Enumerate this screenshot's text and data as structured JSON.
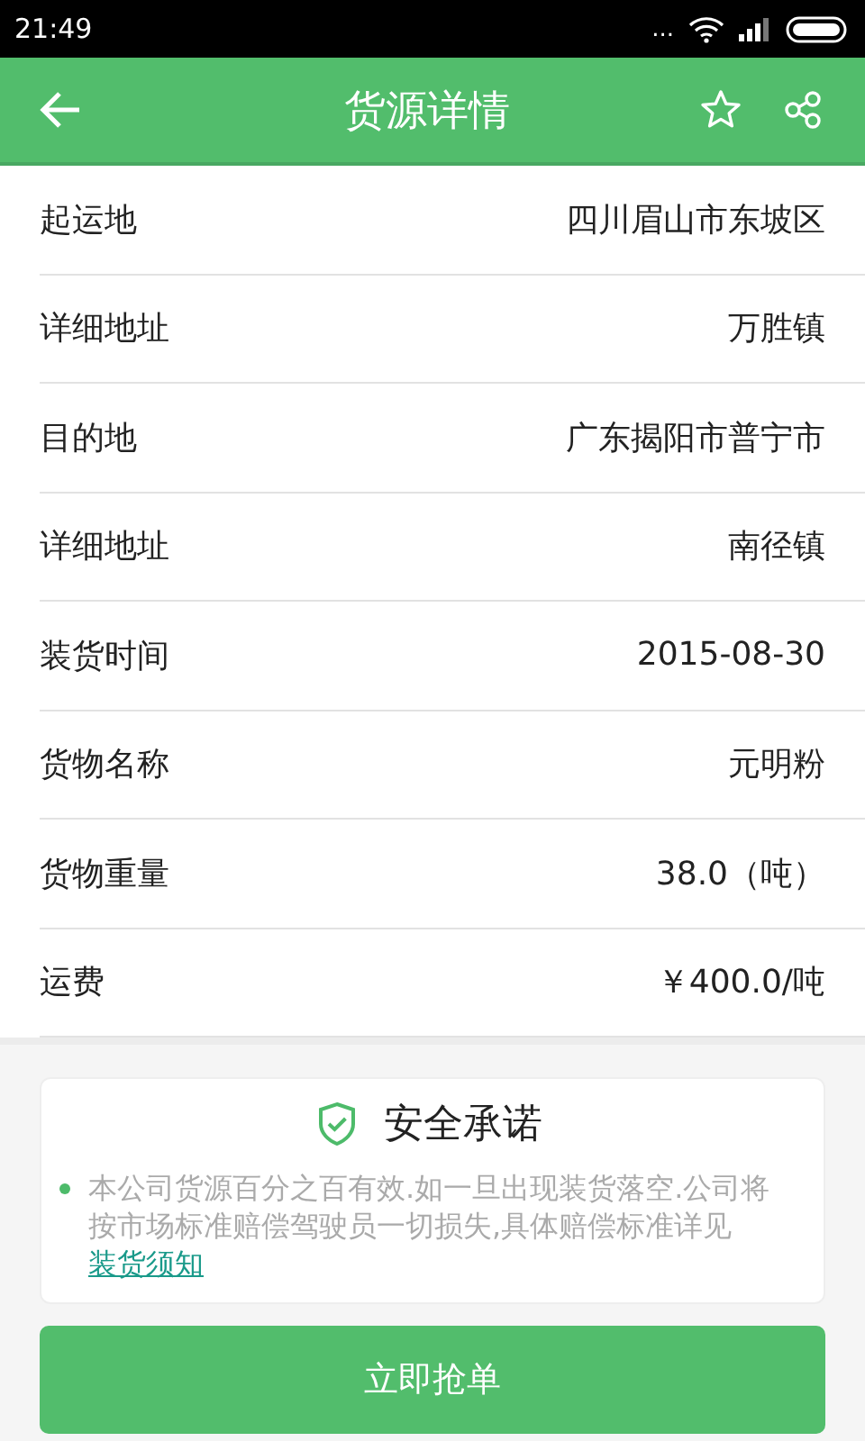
{
  "status_bar": {
    "time": "21:49",
    "dots": "..."
  },
  "header": {
    "title": "货源详情"
  },
  "rows": [
    {
      "label": "起运地",
      "value": "四川眉山市东坡区"
    },
    {
      "label": "详细地址",
      "value": "万胜镇"
    },
    {
      "label": "目的地",
      "value": "广东揭阳市普宁市"
    },
    {
      "label": "详细地址",
      "value": "南径镇"
    },
    {
      "label": "装货时间",
      "value": "2015-08-30"
    },
    {
      "label": "货物名称",
      "value": "元明粉"
    },
    {
      "label": "货物重量",
      "value": "38.0（吨）"
    },
    {
      "label": "运费",
      "value": "￥400.0/吨"
    }
  ],
  "notice": {
    "title": "安全承诺",
    "text": "本公司货源百分之百有效.如一旦出现装货落空.公司将按市场标准赔偿驾驶员一切损失,具体赔偿标准详见",
    "link": "装货须知"
  },
  "button": "立即抢单"
}
